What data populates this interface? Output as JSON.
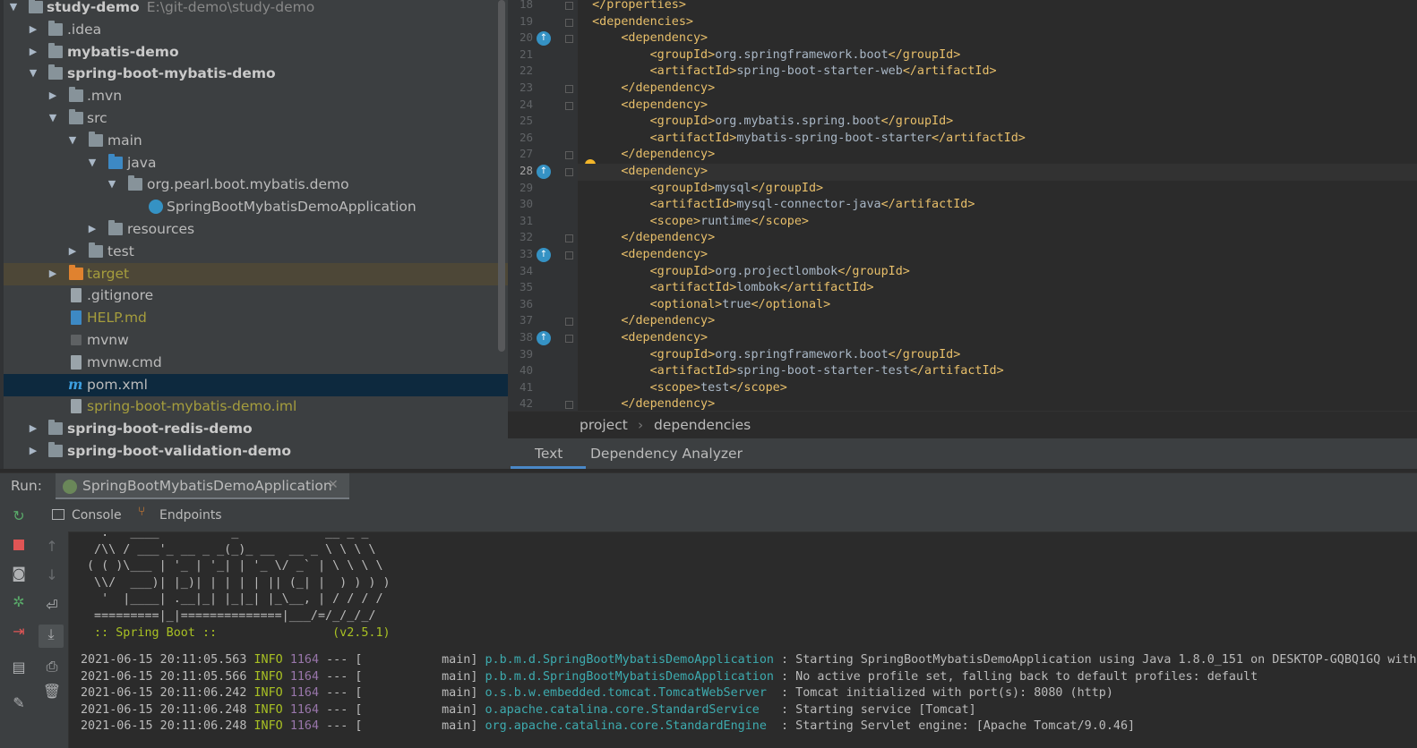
{
  "project_tree": {
    "root": {
      "name": "study-demo",
      "path": "E:\\git-demo\\study-demo"
    },
    "items": [
      {
        "label": ".idea"
      },
      {
        "label": "mybatis-demo"
      },
      {
        "label": "spring-boot-mybatis-demo"
      },
      {
        "label": ".mvn"
      },
      {
        "label": "src"
      },
      {
        "label": "main"
      },
      {
        "label": "java"
      },
      {
        "label": "org.pearl.boot.mybatis.demo"
      },
      {
        "label": "SpringBootMybatisDemoApplication"
      },
      {
        "label": "resources"
      },
      {
        "label": "test"
      },
      {
        "label": "target"
      },
      {
        "label": ".gitignore"
      },
      {
        "label": "HELP.md"
      },
      {
        "label": "mvnw"
      },
      {
        "label": "mvnw.cmd"
      },
      {
        "label": "pom.xml"
      },
      {
        "label": "spring-boot-mybatis-demo.iml"
      },
      {
        "label": "spring-boot-redis-demo"
      },
      {
        "label": "spring-boot-validation-demo"
      }
    ]
  },
  "editor": {
    "lines": [
      {
        "n": "18",
        "open": "</",
        "name": "properties",
        "close": ">",
        "text": "",
        "close_tag": ""
      },
      {
        "n": "19",
        "text": "<dependencies>"
      },
      {
        "n": "20",
        "text": "<dependency>"
      },
      {
        "n": "21",
        "tag": "groupId",
        "value": "org.springframework.boot"
      },
      {
        "n": "22",
        "tag": "artifactId",
        "value": "spring-boot-starter-web"
      },
      {
        "n": "23",
        "text": "</dependency>"
      },
      {
        "n": "24",
        "text": "<dependency>"
      },
      {
        "n": "25",
        "tag": "groupId",
        "value": "org.mybatis.spring.boot"
      },
      {
        "n": "26",
        "tag": "artifactId",
        "value": "mybatis-spring-boot-starter"
      },
      {
        "n": "27",
        "text": "</dependency>"
      },
      {
        "n": "28",
        "text": "<dependency>"
      },
      {
        "n": "29",
        "tag": "groupId",
        "value": "mysql"
      },
      {
        "n": "30",
        "tag": "artifactId",
        "value": "mysql-connector-java"
      },
      {
        "n": "31",
        "tag": "scope",
        "value": "runtime"
      },
      {
        "n": "32",
        "text": "</dependency>"
      },
      {
        "n": "33",
        "text": "<dependency>"
      },
      {
        "n": "34",
        "tag": "groupId",
        "value": "org.projectlombok"
      },
      {
        "n": "35",
        "tag": "artifactId",
        "value": "lombok"
      },
      {
        "n": "36",
        "tag": "optional",
        "value": "true"
      },
      {
        "n": "37",
        "text": "</dependency>"
      },
      {
        "n": "38",
        "text": "<dependency>"
      },
      {
        "n": "39",
        "tag": "groupId",
        "value": "org.springframework.boot"
      },
      {
        "n": "40",
        "tag": "artifactId",
        "value": "spring-boot-starter-test"
      },
      {
        "n": "41",
        "tag": "scope",
        "value": "test"
      },
      {
        "n": "42",
        "text": "</dependency>"
      }
    ],
    "line18": "</properties>",
    "breadcrumb": [
      "project",
      "dependencies"
    ],
    "tabs": [
      "Text",
      "Dependency Analyzer"
    ]
  },
  "run": {
    "label": "Run:",
    "tab": "SpringBootMybatisDemoApplication",
    "subtabs": [
      "Console",
      "Endpoints"
    ],
    "banner": [
      "  .   ____          _            __ _ _",
      " /\\\\ / ___'_ __ _ _(_)_ __  __ _ \\ \\ \\ \\",
      "( ( )\\___ | '_ | '_| | '_ \\/ _` | \\ \\ \\ \\",
      " \\\\/  ___)| |_)| | | | | || (_| |  ) ) ) )",
      "  '  |____| .__|_| |_|_| |_\\__, | / / / /",
      " =========|_|==============|___/=/_/_/_/"
    ],
    "spring_boot": " :: Spring Boot ::                (v2.5.1)",
    "logs": [
      {
        "time": "2021-06-15 20:11:05.563",
        "level": "INFO",
        "pid": "1164",
        "sep": "--- [           main]",
        "logger": "p.b.m.d.SpringBootMybatisDemoApplication",
        "msg": ": Starting SpringBootMybatisDemoApplication using Java 1.8.0_151 on DESKTOP-GQBQ1GQ with"
      },
      {
        "time": "2021-06-15 20:11:05.566",
        "level": "INFO",
        "pid": "1164",
        "sep": "--- [           main]",
        "logger": "p.b.m.d.SpringBootMybatisDemoApplication",
        "msg": ": No active profile set, falling back to default profiles: default"
      },
      {
        "time": "2021-06-15 20:11:06.242",
        "level": "INFO",
        "pid": "1164",
        "sep": "--- [           main]",
        "logger": "o.s.b.w.embedded.tomcat.TomcatWebServer ",
        "msg": ": Tomcat initialized with port(s): 8080 (http)"
      },
      {
        "time": "2021-06-15 20:11:06.248",
        "level": "INFO",
        "pid": "1164",
        "sep": "--- [           main]",
        "logger": "o.apache.catalina.core.StandardService  ",
        "msg": ": Starting service [Tomcat]"
      },
      {
        "time": "2021-06-15 20:11:06.248",
        "level": "INFO",
        "pid": "1164",
        "sep": "--- [           main]",
        "logger": "org.apache.catalina.core.StandardEngine ",
        "msg": ": Starting Servlet engine: [Apache Tomcat/9.0.46]"
      }
    ]
  },
  "colors": {
    "accent": "#4a88c7",
    "tag": "#e8bf6a",
    "info": "#a8c023",
    "logger": "#3dabaf"
  }
}
